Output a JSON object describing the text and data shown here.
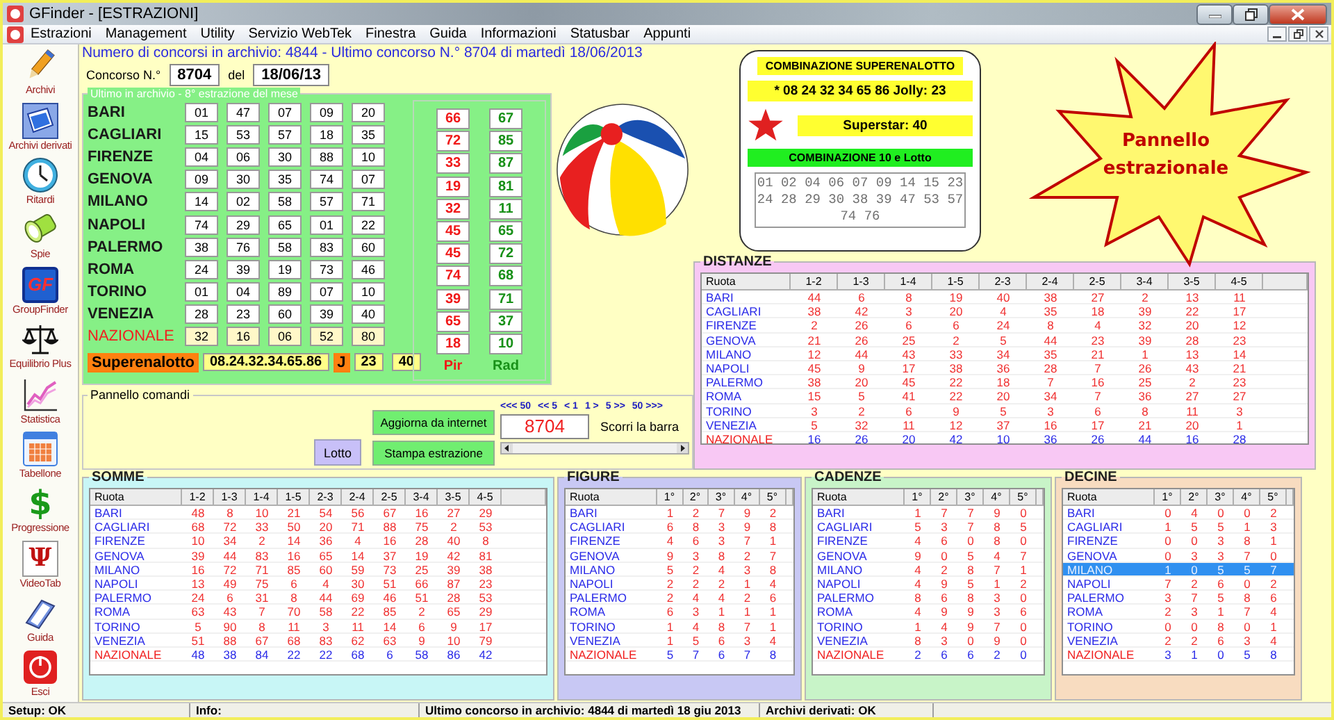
{
  "window": {
    "title": "GFinder - [ESTRAZIONI]"
  },
  "menu": [
    "Estrazioni",
    "Management",
    "Utility",
    "Servizio WebTek",
    "Finestra",
    "Guida",
    "Informazioni",
    "Statusbar",
    "Appunti"
  ],
  "sidebar": [
    {
      "label": "Archivi",
      "kind": "pencil"
    },
    {
      "label": "Archivi derivati",
      "kind": "notebook"
    },
    {
      "label": "Ritardi",
      "kind": "clock"
    },
    {
      "label": "Spie",
      "kind": "flashlight"
    },
    {
      "label": "GroupFinder",
      "kind": "logo",
      "glyph": "GF"
    },
    {
      "label": "Equilibrio Plus",
      "kind": "scales"
    },
    {
      "label": "Statistica",
      "kind": "chart"
    },
    {
      "label": "Tabellone",
      "kind": "calendar"
    },
    {
      "label": "Progressione",
      "kind": "dollar",
      "glyph": "$"
    },
    {
      "label": "VideoTab",
      "kind": "psi",
      "glyph": "Ψ"
    },
    {
      "label": "Guida",
      "kind": "book"
    },
    {
      "label": "Esci",
      "kind": "power"
    }
  ],
  "header": {
    "archive_info": "Numero di concorsi in archivio: 4844  -  Ultimo concorso N.° 8704 di martedì 18/06/2013",
    "concorso_label": "Concorso N.°",
    "concorso": "8704",
    "del_label": "del",
    "date": "18/06/13"
  },
  "estrazione": {
    "legend": "Ultimo in archivio - 8° estrazione del mese",
    "pir_label": "Pir",
    "rad_label": "Rad",
    "rows": [
      {
        "ruota": "BARI",
        "kind": "ruota",
        "numbers": [
          "01",
          "47",
          "07",
          "09",
          "20"
        ],
        "pir": "66",
        "rad": "67"
      },
      {
        "ruota": "CAGLIARI",
        "kind": "ruota",
        "numbers": [
          "15",
          "53",
          "57",
          "18",
          "35"
        ],
        "pir": "72",
        "rad": "85"
      },
      {
        "ruota": "FIRENZE",
        "kind": "ruota",
        "numbers": [
          "04",
          "06",
          "30",
          "88",
          "10"
        ],
        "pir": "33",
        "rad": "87"
      },
      {
        "ruota": "GENOVA",
        "kind": "ruota",
        "numbers": [
          "09",
          "30",
          "35",
          "74",
          "07"
        ],
        "pir": "19",
        "rad": "81"
      },
      {
        "ruota": "MILANO",
        "kind": "ruota",
        "numbers": [
          "14",
          "02",
          "58",
          "57",
          "71"
        ],
        "pir": "32",
        "rad": "11"
      },
      {
        "ruota": "NAPOLI",
        "kind": "ruota",
        "numbers": [
          "74",
          "29",
          "65",
          "01",
          "22"
        ],
        "pir": "45",
        "rad": "65"
      },
      {
        "ruota": "PALERMO",
        "kind": "ruota",
        "numbers": [
          "38",
          "76",
          "58",
          "83",
          "60"
        ],
        "pir": "45",
        "rad": "72"
      },
      {
        "ruota": "ROMA",
        "kind": "ruota",
        "numbers": [
          "24",
          "39",
          "19",
          "73",
          "46"
        ],
        "pir": "74",
        "rad": "68"
      },
      {
        "ruota": "TORINO",
        "kind": "ruota",
        "numbers": [
          "01",
          "04",
          "89",
          "07",
          "10"
        ],
        "pir": "39",
        "rad": "71"
      },
      {
        "ruota": "VENEZIA",
        "kind": "ruota",
        "numbers": [
          "28",
          "23",
          "60",
          "39",
          "40"
        ],
        "pir": "65",
        "rad": "37"
      },
      {
        "ruota": "NAZIONALE",
        "kind": "nazionale",
        "numbers": [
          "32",
          "16",
          "06",
          "52",
          "80"
        ],
        "pir": "18",
        "rad": "10"
      }
    ],
    "superenalotto": {
      "label": "Superenalotto",
      "numbers": "08.24.32.34.65.86",
      "jolly_label": "J",
      "jolly": "23",
      "superstar": "40"
    }
  },
  "combinazione": {
    "title": "COMBINAZIONE SUPERENALOTTO",
    "line": "* 08 24 32 34 65 86   Jolly: 23",
    "superstar": "Superstar: 40",
    "lotto_title": "COMBINAZIONE 10 e Lotto",
    "lotto_numbers": "01 02 04 06 07 09 14 15 23 24 28 29 30 38 39 47 53 57 74 76"
  },
  "callout": "Pannello estrazionale",
  "comandi": {
    "legend": "Pannello comandi",
    "lotto_button": "Lotto",
    "buttons": [
      "Aggiorna da internet",
      "Stampa estrazione"
    ],
    "nav": [
      "<<< 50",
      "<< 5",
      "< 1",
      "1 >",
      "5 >>",
      "50 >>>"
    ],
    "concorso": "8704",
    "scroll_label": "Scorri la barra"
  },
  "distanze": {
    "title": "DISTANZE",
    "columns": [
      "Ruota",
      "1-2",
      "1-3",
      "1-4",
      "1-5",
      "2-3",
      "2-4",
      "2-5",
      "3-4",
      "3-5",
      "4-5"
    ],
    "rows": [
      {
        "ruota": "BARI",
        "kind": "ruota",
        "values": [
          "44",
          "6",
          "8",
          "19",
          "40",
          "38",
          "27",
          "2",
          "13",
          "11"
        ]
      },
      {
        "ruota": "CAGLIARI",
        "kind": "ruota",
        "values": [
          "38",
          "42",
          "3",
          "20",
          "4",
          "35",
          "18",
          "39",
          "22",
          "17"
        ]
      },
      {
        "ruota": "FIRENZE",
        "kind": "ruota",
        "values": [
          "2",
          "26",
          "6",
          "6",
          "24",
          "8",
          "4",
          "32",
          "20",
          "12"
        ]
      },
      {
        "ruota": "GENOVA",
        "kind": "ruota",
        "values": [
          "21",
          "26",
          "25",
          "2",
          "5",
          "44",
          "23",
          "39",
          "28",
          "23"
        ]
      },
      {
        "ruota": "MILANO",
        "kind": "ruota",
        "values": [
          "12",
          "44",
          "43",
          "33",
          "34",
          "35",
          "21",
          "1",
          "13",
          "14"
        ]
      },
      {
        "ruota": "NAPOLI",
        "kind": "ruota",
        "values": [
          "45",
          "9",
          "17",
          "38",
          "36",
          "28",
          "7",
          "26",
          "43",
          "21"
        ]
      },
      {
        "ruota": "PALERMO",
        "kind": "ruota",
        "values": [
          "38",
          "20",
          "45",
          "22",
          "18",
          "7",
          "16",
          "25",
          "2",
          "23"
        ]
      },
      {
        "ruota": "ROMA",
        "kind": "ruota",
        "values": [
          "15",
          "5",
          "41",
          "22",
          "20",
          "34",
          "7",
          "36",
          "27",
          "27"
        ]
      },
      {
        "ruota": "TORINO",
        "kind": "ruota",
        "values": [
          "3",
          "2",
          "6",
          "9",
          "5",
          "3",
          "6",
          "8",
          "11",
          "3"
        ]
      },
      {
        "ruota": "VENEZIA",
        "kind": "ruota",
        "values": [
          "5",
          "32",
          "11",
          "12",
          "37",
          "16",
          "17",
          "21",
          "20",
          "1"
        ]
      },
      {
        "ruota": "NAZIONALE",
        "kind": "nazionale",
        "values": [
          "16",
          "26",
          "20",
          "42",
          "10",
          "36",
          "26",
          "44",
          "16",
          "28"
        ]
      }
    ]
  },
  "somme": {
    "title": "SOMME",
    "columns": [
      "Ruota",
      "1-2",
      "1-3",
      "1-4",
      "1-5",
      "2-3",
      "2-4",
      "2-5",
      "3-4",
      "3-5",
      "4-5"
    ],
    "rows": [
      {
        "ruota": "BARI",
        "kind": "ruota",
        "values": [
          "48",
          "8",
          "10",
          "21",
          "54",
          "56",
          "67",
          "16",
          "27",
          "29"
        ]
      },
      {
        "ruota": "CAGLIARI",
        "kind": "ruota",
        "values": [
          "68",
          "72",
          "33",
          "50",
          "20",
          "71",
          "88",
          "75",
          "2",
          "53"
        ]
      },
      {
        "ruota": "FIRENZE",
        "kind": "ruota",
        "values": [
          "10",
          "34",
          "2",
          "14",
          "36",
          "4",
          "16",
          "28",
          "40",
          "8"
        ]
      },
      {
        "ruota": "GENOVA",
        "kind": "ruota",
        "values": [
          "39",
          "44",
          "83",
          "16",
          "65",
          "14",
          "37",
          "19",
          "42",
          "81"
        ]
      },
      {
        "ruota": "MILANO",
        "kind": "ruota",
        "values": [
          "16",
          "72",
          "71",
          "85",
          "60",
          "59",
          "73",
          "25",
          "39",
          "38"
        ]
      },
      {
        "ruota": "NAPOLI",
        "kind": "ruota",
        "values": [
          "13",
          "49",
          "75",
          "6",
          "4",
          "30",
          "51",
          "66",
          "87",
          "23"
        ]
      },
      {
        "ruota": "PALERMO",
        "kind": "ruota",
        "values": [
          "24",
          "6",
          "31",
          "8",
          "44",
          "69",
          "46",
          "51",
          "28",
          "53"
        ]
      },
      {
        "ruota": "ROMA",
        "kind": "ruota",
        "values": [
          "63",
          "43",
          "7",
          "70",
          "58",
          "22",
          "85",
          "2",
          "65",
          "29"
        ]
      },
      {
        "ruota": "TORINO",
        "kind": "ruota",
        "values": [
          "5",
          "90",
          "8",
          "11",
          "3",
          "11",
          "14",
          "6",
          "9",
          "17"
        ]
      },
      {
        "ruota": "VENEZIA",
        "kind": "ruota",
        "values": [
          "51",
          "88",
          "67",
          "68",
          "83",
          "62",
          "63",
          "9",
          "10",
          "79"
        ]
      },
      {
        "ruota": "NAZIONALE",
        "kind": "nazionale",
        "values": [
          "48",
          "38",
          "84",
          "22",
          "22",
          "68",
          "6",
          "58",
          "86",
          "42"
        ]
      }
    ]
  },
  "figure": {
    "title": "FIGURE",
    "columns": [
      "Ruota",
      "1°",
      "2°",
      "3°",
      "4°",
      "5°"
    ],
    "rows": [
      {
        "ruota": "BARI",
        "kind": "ruota",
        "values": [
          "1",
          "2",
          "7",
          "9",
          "2"
        ]
      },
      {
        "ruota": "CAGLIARI",
        "kind": "ruota",
        "values": [
          "6",
          "8",
          "3",
          "9",
          "8"
        ]
      },
      {
        "ruota": "FIRENZE",
        "kind": "ruota",
        "values": [
          "4",
          "6",
          "3",
          "7",
          "1"
        ]
      },
      {
        "ruota": "GENOVA",
        "kind": "ruota",
        "values": [
          "9",
          "3",
          "8",
          "2",
          "7"
        ]
      },
      {
        "ruota": "MILANO",
        "kind": "ruota",
        "values": [
          "5",
          "2",
          "4",
          "3",
          "8"
        ]
      },
      {
        "ruota": "NAPOLI",
        "kind": "ruota",
        "values": [
          "2",
          "2",
          "2",
          "1",
          "4"
        ]
      },
      {
        "ruota": "PALERMO",
        "kind": "ruota",
        "values": [
          "2",
          "4",
          "4",
          "2",
          "6"
        ]
      },
      {
        "ruota": "ROMA",
        "kind": "ruota",
        "values": [
          "6",
          "3",
          "1",
          "1",
          "1"
        ]
      },
      {
        "ruota": "TORINO",
        "kind": "ruota",
        "values": [
          "1",
          "4",
          "8",
          "7",
          "1"
        ]
      },
      {
        "ruota": "VENEZIA",
        "kind": "ruota",
        "values": [
          "1",
          "5",
          "6",
          "3",
          "4"
        ]
      },
      {
        "ruota": "NAZIONALE",
        "kind": "nazionale",
        "values": [
          "5",
          "7",
          "6",
          "7",
          "8"
        ]
      }
    ]
  },
  "cadenze": {
    "title": "CADENZE",
    "columns": [
      "Ruota",
      "1°",
      "2°",
      "3°",
      "4°",
      "5°"
    ],
    "rows": [
      {
        "ruota": "BARI",
        "kind": "ruota",
        "values": [
          "1",
          "7",
          "7",
          "9",
          "0"
        ]
      },
      {
        "ruota": "CAGLIARI",
        "kind": "ruota",
        "values": [
          "5",
          "3",
          "7",
          "8",
          "5"
        ]
      },
      {
        "ruota": "FIRENZE",
        "kind": "ruota",
        "values": [
          "4",
          "6",
          "0",
          "8",
          "0"
        ]
      },
      {
        "ruota": "GENOVA",
        "kind": "ruota",
        "values": [
          "9",
          "0",
          "5",
          "4",
          "7"
        ]
      },
      {
        "ruota": "MILANO",
        "kind": "ruota",
        "values": [
          "4",
          "2",
          "8",
          "7",
          "1"
        ]
      },
      {
        "ruota": "NAPOLI",
        "kind": "ruota",
        "values": [
          "4",
          "9",
          "5",
          "1",
          "2"
        ]
      },
      {
        "ruota": "PALERMO",
        "kind": "ruota",
        "values": [
          "8",
          "6",
          "8",
          "3",
          "0"
        ]
      },
      {
        "ruota": "ROMA",
        "kind": "ruota",
        "values": [
          "4",
          "9",
          "9",
          "3",
          "6"
        ]
      },
      {
        "ruota": "TORINO",
        "kind": "ruota",
        "values": [
          "1",
          "4",
          "9",
          "7",
          "0"
        ]
      },
      {
        "ruota": "VENEZIA",
        "kind": "ruota",
        "values": [
          "8",
          "3",
          "0",
          "9",
          "0"
        ]
      },
      {
        "ruota": "NAZIONALE",
        "kind": "nazionale",
        "values": [
          "2",
          "6",
          "6",
          "2",
          "0"
        ]
      }
    ]
  },
  "decine": {
    "title": "DECINE",
    "columns": [
      "Ruota",
      "1°",
      "2°",
      "3°",
      "4°",
      "5°"
    ],
    "rows": [
      {
        "ruota": "BARI",
        "kind": "ruota",
        "selected": false,
        "values": [
          "0",
          "4",
          "0",
          "0",
          "2"
        ]
      },
      {
        "ruota": "CAGLIARI",
        "kind": "ruota",
        "selected": false,
        "values": [
          "1",
          "5",
          "5",
          "1",
          "3"
        ]
      },
      {
        "ruota": "FIRENZE",
        "kind": "ruota",
        "selected": false,
        "values": [
          "0",
          "0",
          "3",
          "8",
          "1"
        ]
      },
      {
        "ruota": "GENOVA",
        "kind": "ruota",
        "selected": false,
        "values": [
          "0",
          "3",
          "3",
          "7",
          "0"
        ]
      },
      {
        "ruota": "MILANO",
        "kind": "ruota",
        "selected": true,
        "values": [
          "1",
          "0",
          "5",
          "5",
          "7"
        ]
      },
      {
        "ruota": "NAPOLI",
        "kind": "ruota",
        "selected": false,
        "values": [
          "7",
          "2",
          "6",
          "0",
          "2"
        ]
      },
      {
        "ruota": "PALERMO",
        "kind": "ruota",
        "selected": false,
        "values": [
          "3",
          "7",
          "5",
          "8",
          "6"
        ]
      },
      {
        "ruota": "ROMA",
        "kind": "ruota",
        "selected": false,
        "values": [
          "2",
          "3",
          "1",
          "7",
          "4"
        ]
      },
      {
        "ruota": "TORINO",
        "kind": "ruota",
        "selected": false,
        "values": [
          "0",
          "0",
          "8",
          "0",
          "1"
        ]
      },
      {
        "ruota": "VENEZIA",
        "kind": "ruota",
        "selected": false,
        "values": [
          "2",
          "2",
          "6",
          "3",
          "4"
        ]
      },
      {
        "ruota": "NAZIONALE",
        "kind": "nazionale",
        "selected": false,
        "values": [
          "3",
          "1",
          "0",
          "5",
          "8"
        ]
      }
    ]
  },
  "status_bar": [
    "Setup: OK",
    "Info:",
    "Ultimo concorso in archivio: 4844 di martedì 18 giu 2013",
    "Archivi derivati: OK"
  ]
}
